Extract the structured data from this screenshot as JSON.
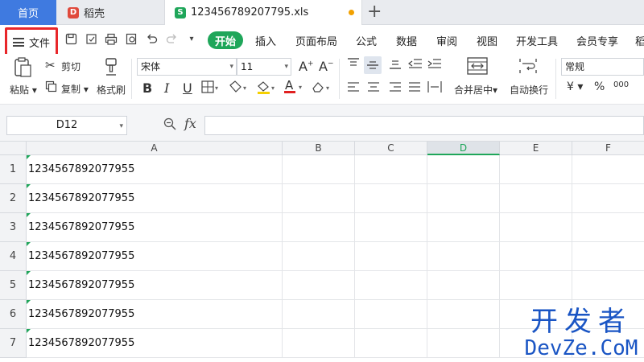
{
  "tabs": {
    "home": "首页",
    "daoke": "稻壳",
    "daoke_icon": "D",
    "file": "123456789207795.xls",
    "file_icon": "S",
    "new_tab": "+"
  },
  "menu": {
    "file": "文件",
    "start": "开始",
    "items": [
      "插入",
      "页面布局",
      "公式",
      "数据",
      "审阅",
      "视图",
      "开发工具",
      "会员专享",
      "稻"
    ]
  },
  "ribbon": {
    "paste": "粘贴",
    "cut": "剪切",
    "copy": "复制",
    "format_painter": "格式刷",
    "font_name": "宋体",
    "font_size": "11",
    "merge": "合并居中",
    "wrap": "自动换行",
    "number_format": "常规",
    "currency": "¥",
    "percent": "%",
    "thousands": "000"
  },
  "formula_bar": {
    "cell_ref": "D12",
    "fx": "fx",
    "value": ""
  },
  "sheet": {
    "columns": [
      "A",
      "B",
      "C",
      "D",
      "E",
      "F"
    ],
    "active_column": "D",
    "rows": [
      {
        "num": "1",
        "a": "1234567892077955"
      },
      {
        "num": "2",
        "a": "1234567892077955"
      },
      {
        "num": "3",
        "a": "1234567892077955"
      },
      {
        "num": "4",
        "a": "1234567892077955"
      },
      {
        "num": "5",
        "a": "1234567892077955"
      },
      {
        "num": "6",
        "a": "1234567892077955"
      },
      {
        "num": "7",
        "a": "1234567892077955"
      }
    ]
  },
  "watermark": {
    "top": "开发者",
    "bottom": "DevZe.CoM"
  },
  "colors": {
    "accent_green": "#1fa65a",
    "home_tab_blue": "#3f7ae0",
    "highlight_red": "#e8262a",
    "watermark_blue": "#1a55c4"
  }
}
